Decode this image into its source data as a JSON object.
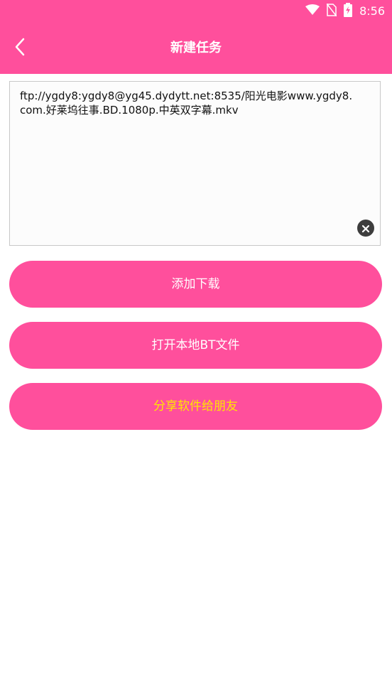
{
  "status_bar": {
    "time": "8:56",
    "icons": [
      "wifi-icon",
      "no-sim-icon",
      "battery-charging-icon"
    ]
  },
  "app_bar": {
    "title": "新建任务",
    "back_icon": "chevron-left-icon"
  },
  "url_input": {
    "value": "ftp://ygdy8:ygdy8@yg45.dydytt.net:8535/阳光电影www.ygdy8.com.好莱坞往事.BD.1080p.中英双字幕.mkv",
    "clear_icon": "clear-icon"
  },
  "buttons": {
    "add_download": "添加下载",
    "open_local_bt": "打开本地BT文件",
    "share_app": "分享软件给朋友"
  },
  "colors": {
    "accent": "#ff4f9c",
    "share_text": "#ffe600"
  }
}
